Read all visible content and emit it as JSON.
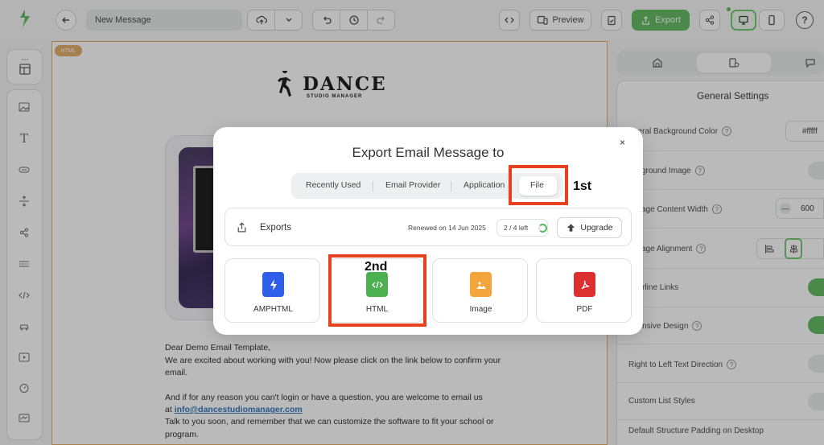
{
  "toolbar": {
    "message_name": "New Message",
    "preview_label": "Preview",
    "export_label": "Export"
  },
  "canvas": {
    "block_tag": "HTML",
    "brand_title": "DANCE",
    "brand_subtitle": "STUDIO MANAGER",
    "greeting": "Dear Demo Email Template,",
    "line1": "We are excited about working with you! Now please click on the link below to confirm your",
    "line1b": "email.",
    "line2": "And if for any reason you can't login or have a question, you are welcome to email us",
    "line3_prefix": "at",
    "email_link": "info@dancestudiomanager.com",
    "line4": "Talk to you soon, and remember that we can customize the software to fit your school or",
    "line5": "program."
  },
  "settings": {
    "title": "General Settings",
    "rows": [
      {
        "label": "neral Background Color",
        "value": "#fffff"
      },
      {
        "label": "ckground Image"
      },
      {
        "label": "ssage Content Width",
        "value": "600"
      },
      {
        "label": "ssage Alignment"
      },
      {
        "label": "derline Links"
      },
      {
        "label": "ponsive Design"
      },
      {
        "label": "Right to Left Text Direction"
      },
      {
        "label": "Custom List Styles"
      },
      {
        "label": "Default Structure Padding on Desktop"
      }
    ],
    "stepper_minus": "—"
  },
  "modal": {
    "title": "Export Email Message to",
    "close": "×",
    "tabs": [
      "Recently Used",
      "Email Provider",
      "Application",
      "File"
    ],
    "exports_label": "Exports",
    "renewed": "Renewed on 14 Jun 2025",
    "quota": "2 / 4 left",
    "upgrade_label": "Upgrade",
    "formats": [
      {
        "label": "AMPHTML",
        "color": "#2f5ee8"
      },
      {
        "label": "HTML",
        "color": "#4caf50"
      },
      {
        "label": "Image",
        "color": "#f3a43a"
      },
      {
        "label": "PDF",
        "color": "#dc2f2f"
      }
    ]
  },
  "annotations": {
    "first": "1st",
    "second": "2nd"
  },
  "colors": {
    "accent": "#5bb75b",
    "highlight": "#e8411f",
    "block_border": "#e1a860"
  }
}
